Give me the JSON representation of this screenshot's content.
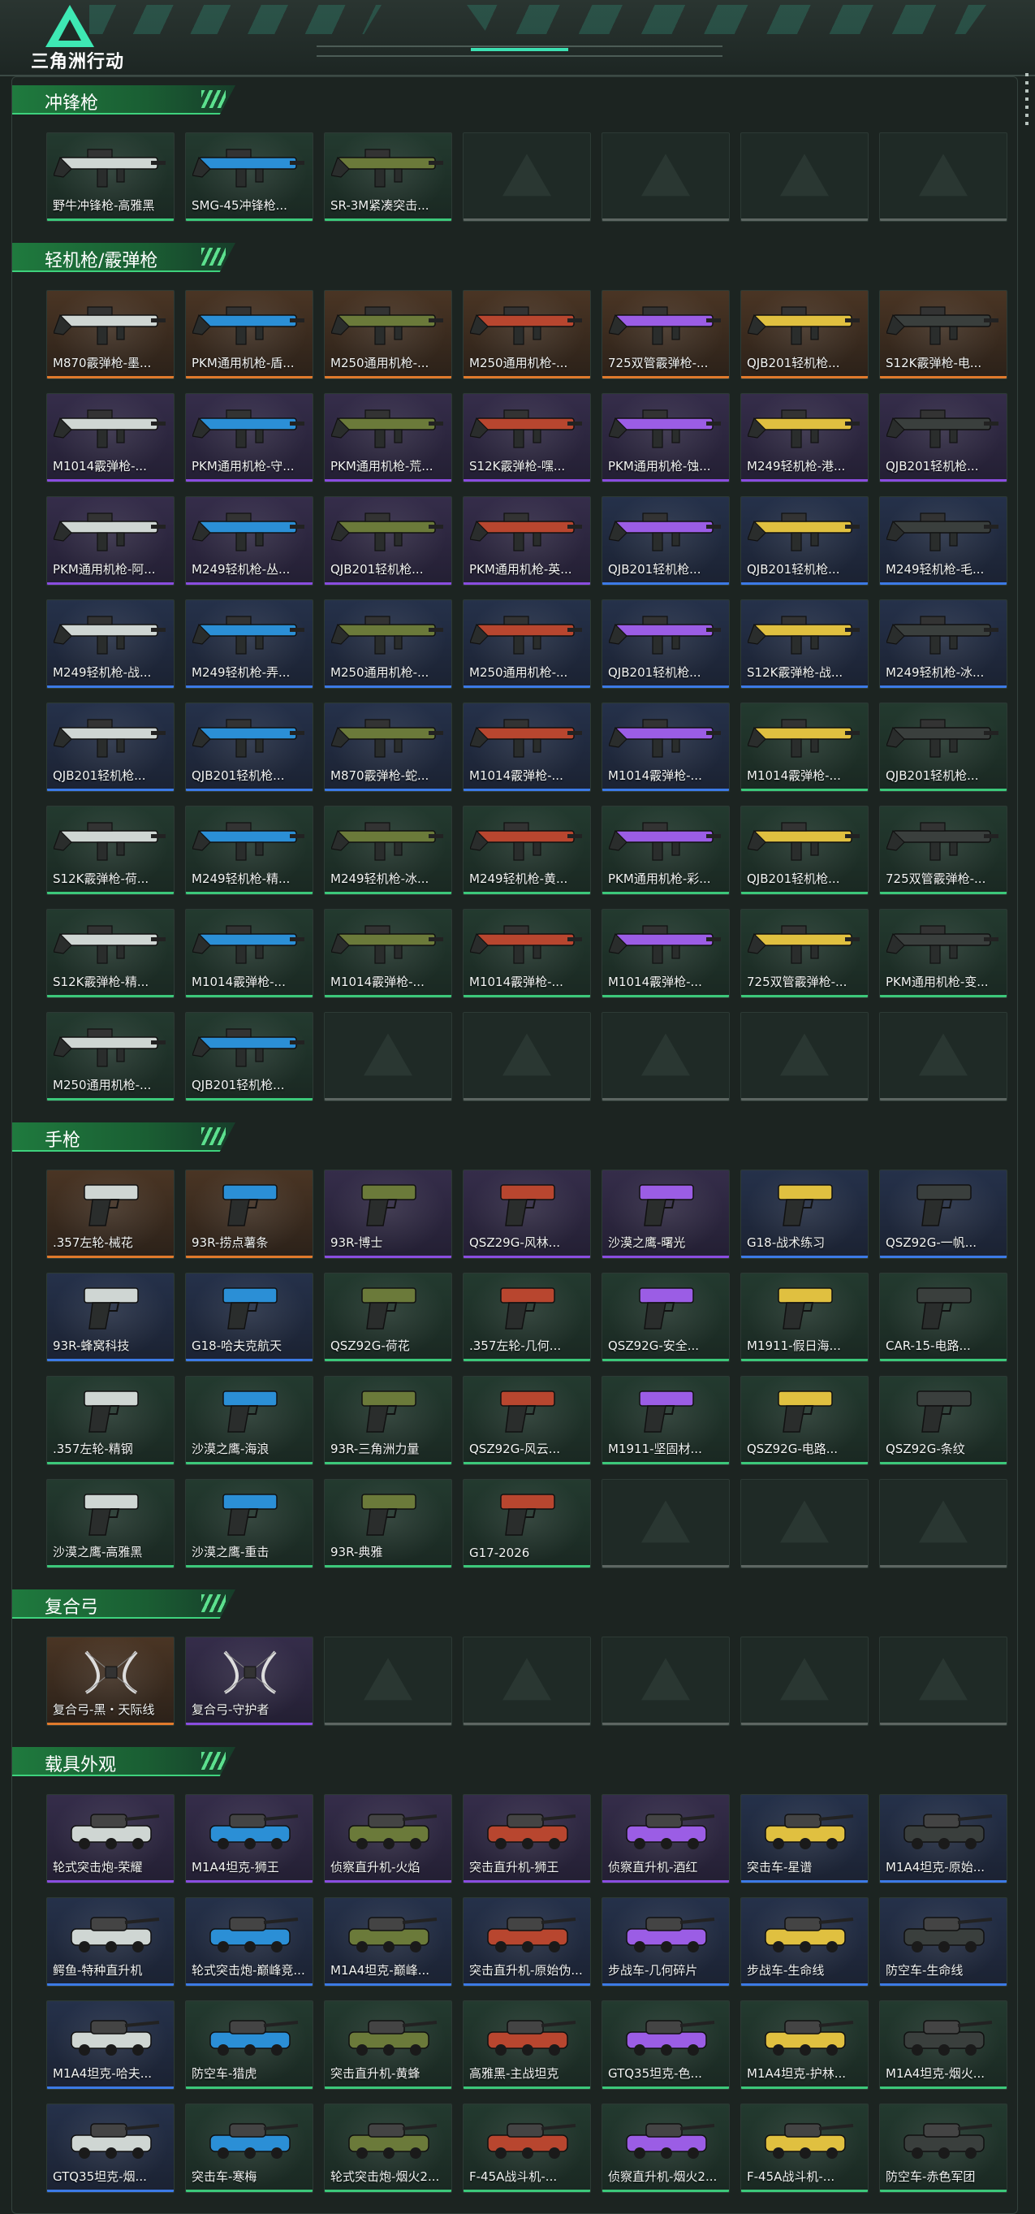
{
  "header": {
    "logo_text": "三角洲行动"
  },
  "colors": {
    "orange": "#e07a2c",
    "purple": "#8a4de0",
    "blue": "#3c7ae6",
    "green": "#3cc87a",
    "accent": "#3ee8b4"
  },
  "sections": [
    {
      "title": "冲锋枪",
      "icon": "gun",
      "items": [
        {
          "label": "野牛冲锋枪-高雅黑",
          "rarity": "green"
        },
        {
          "label": "SMG-45冲锋枪...",
          "rarity": "green"
        },
        {
          "label": "SR-3M紧凑突击...",
          "rarity": "green"
        }
      ],
      "empty_slots": 4
    },
    {
      "title": "轻机枪/霰弹枪",
      "icon": "gun",
      "items": [
        {
          "label": "M870霰弹枪-墨...",
          "rarity": "orange"
        },
        {
          "label": "PKM通用机枪-盾...",
          "rarity": "orange"
        },
        {
          "label": "M250通用机枪-...",
          "rarity": "orange"
        },
        {
          "label": "M250通用机枪-...",
          "rarity": "orange"
        },
        {
          "label": "725双管霰弹枪-...",
          "rarity": "orange"
        },
        {
          "label": "QJB201轻机枪...",
          "rarity": "orange"
        },
        {
          "label": "S12K霰弹枪-电...",
          "rarity": "orange"
        },
        {
          "label": "M1014霰弹枪-...",
          "rarity": "purple"
        },
        {
          "label": "PKM通用机枪-守...",
          "rarity": "purple"
        },
        {
          "label": "PKM通用机枪-荒...",
          "rarity": "purple"
        },
        {
          "label": "S12K霰弹枪-嘿...",
          "rarity": "purple"
        },
        {
          "label": "PKM通用机枪-蚀...",
          "rarity": "purple"
        },
        {
          "label": "M249轻机枪-港...",
          "rarity": "purple"
        },
        {
          "label": "QJB201轻机枪...",
          "rarity": "purple"
        },
        {
          "label": "PKM通用机枪-阿...",
          "rarity": "purple"
        },
        {
          "label": "M249轻机枪-丛...",
          "rarity": "purple"
        },
        {
          "label": "QJB201轻机枪...",
          "rarity": "purple"
        },
        {
          "label": "PKM通用机枪-英...",
          "rarity": "purple"
        },
        {
          "label": "QJB201轻机枪...",
          "rarity": "blue"
        },
        {
          "label": "QJB201轻机枪...",
          "rarity": "blue"
        },
        {
          "label": "M249轻机枪-毛...",
          "rarity": "blue"
        },
        {
          "label": "M249轻机枪-战...",
          "rarity": "blue"
        },
        {
          "label": "M249轻机枪-弄...",
          "rarity": "blue"
        },
        {
          "label": "M250通用机枪-...",
          "rarity": "blue"
        },
        {
          "label": "M250通用机枪-...",
          "rarity": "blue"
        },
        {
          "label": "QJB201轻机枪...",
          "rarity": "blue"
        },
        {
          "label": "S12K霰弹枪-战...",
          "rarity": "blue"
        },
        {
          "label": "M249轻机枪-冰...",
          "rarity": "blue"
        },
        {
          "label": "QJB201轻机枪...",
          "rarity": "blue"
        },
        {
          "label": "QJB201轻机枪...",
          "rarity": "blue"
        },
        {
          "label": "M870霰弹枪-蛇...",
          "rarity": "blue"
        },
        {
          "label": "M1014霰弹枪-...",
          "rarity": "blue"
        },
        {
          "label": "M1014霰弹枪-...",
          "rarity": "blue"
        },
        {
          "label": "M1014霰弹枪-...",
          "rarity": "green"
        },
        {
          "label": "QJB201轻机枪...",
          "rarity": "green"
        },
        {
          "label": "S12K霰弹枪-荷...",
          "rarity": "green"
        },
        {
          "label": "M249轻机枪-精...",
          "rarity": "green"
        },
        {
          "label": "M249轻机枪-冰...",
          "rarity": "green"
        },
        {
          "label": "M249轻机枪-黄...",
          "rarity": "green"
        },
        {
          "label": "PKM通用机枪-彩...",
          "rarity": "green"
        },
        {
          "label": "QJB201轻机枪...",
          "rarity": "green"
        },
        {
          "label": "725双管霰弹枪-...",
          "rarity": "green"
        },
        {
          "label": "S12K霰弹枪-精...",
          "rarity": "green"
        },
        {
          "label": "M1014霰弹枪-...",
          "rarity": "green"
        },
        {
          "label": "M1014霰弹枪-...",
          "rarity": "green"
        },
        {
          "label": "M1014霰弹枪-...",
          "rarity": "green"
        },
        {
          "label": "M1014霰弹枪-...",
          "rarity": "green"
        },
        {
          "label": "725双管霰弹枪-...",
          "rarity": "green"
        },
        {
          "label": "PKM通用机枪-变...",
          "rarity": "green"
        },
        {
          "label": "M250通用机枪-...",
          "rarity": "green"
        },
        {
          "label": "QJB201轻机枪...",
          "rarity": "green"
        }
      ],
      "empty_slots": 5
    },
    {
      "title": "手枪",
      "icon": "pistol",
      "items": [
        {
          "label": ".357左轮-械花",
          "rarity": "orange"
        },
        {
          "label": "93R-捞点薯条",
          "rarity": "orange"
        },
        {
          "label": "93R-博士",
          "rarity": "purple"
        },
        {
          "label": "QSZ29G-风林...",
          "rarity": "purple"
        },
        {
          "label": "沙漠之鹰-曙光",
          "rarity": "purple"
        },
        {
          "label": "G18-战术练习",
          "rarity": "blue"
        },
        {
          "label": "QSZ92G-一帆...",
          "rarity": "blue"
        },
        {
          "label": "93R-蜂窝科技",
          "rarity": "blue"
        },
        {
          "label": "G18-哈夫克航天",
          "rarity": "blue"
        },
        {
          "label": "QSZ92G-荷花",
          "rarity": "green"
        },
        {
          "label": ".357左轮-几何...",
          "rarity": "green"
        },
        {
          "label": "QSZ92G-安全...",
          "rarity": "green"
        },
        {
          "label": "M1911-假日海...",
          "rarity": "green"
        },
        {
          "label": "CAR-15-电路...",
          "rarity": "green"
        },
        {
          "label": ".357左轮-精钢",
          "rarity": "green"
        },
        {
          "label": "沙漠之鹰-海浪",
          "rarity": "green"
        },
        {
          "label": "93R-三角洲力量",
          "rarity": "green"
        },
        {
          "label": "QSZ92G-风云...",
          "rarity": "green"
        },
        {
          "label": "M1911-坚固材...",
          "rarity": "green"
        },
        {
          "label": "QSZ92G-电路...",
          "rarity": "green"
        },
        {
          "label": "QSZ92G-条纹",
          "rarity": "green"
        },
        {
          "label": "沙漠之鹰-高雅黑",
          "rarity": "green"
        },
        {
          "label": "沙漠之鹰-重击",
          "rarity": "green"
        },
        {
          "label": "93R-典雅",
          "rarity": "green"
        },
        {
          "label": "G17-2026",
          "rarity": "green"
        }
      ],
      "empty_slots": 3
    },
    {
      "title": "复合弓",
      "icon": "bow",
      "items": [
        {
          "label": "复合弓-黑・天际线",
          "rarity": "orange"
        },
        {
          "label": "复合弓-守护者",
          "rarity": "purple"
        }
      ],
      "empty_slots": 5
    },
    {
      "title": "载具外观",
      "icon": "vehicle",
      "items": [
        {
          "label": "轮式突击炮-荣耀",
          "rarity": "purple"
        },
        {
          "label": "M1A4坦克-狮王",
          "rarity": "purple"
        },
        {
          "label": "侦察直升机-火焰",
          "rarity": "purple"
        },
        {
          "label": "突击直升机-狮王",
          "rarity": "purple"
        },
        {
          "label": "侦察直升机-酒红",
          "rarity": "purple"
        },
        {
          "label": "突击车-星谱",
          "rarity": "blue"
        },
        {
          "label": "M1A4坦克-原始...",
          "rarity": "blue"
        },
        {
          "label": "鳄鱼-特种直升机",
          "rarity": "blue"
        },
        {
          "label": "轮式突击炮-巅峰竞...",
          "rarity": "blue"
        },
        {
          "label": "M1A4坦克-巅峰...",
          "rarity": "blue"
        },
        {
          "label": "突击直升机-原始伪...",
          "rarity": "blue"
        },
        {
          "label": "步战车-几何碎片",
          "rarity": "blue"
        },
        {
          "label": "步战车-生命线",
          "rarity": "blue"
        },
        {
          "label": "防空车-生命线",
          "rarity": "blue"
        },
        {
          "label": "M1A4坦克-哈夫...",
          "rarity": "blue"
        },
        {
          "label": "防空车-猎虎",
          "rarity": "green"
        },
        {
          "label": "突击直升机-黄蜂",
          "rarity": "green"
        },
        {
          "label": "高雅黑-主战坦克",
          "rarity": "green"
        },
        {
          "label": "GTQ35坦克-色...",
          "rarity": "green"
        },
        {
          "label": "M1A4坦克-护林...",
          "rarity": "green"
        },
        {
          "label": "M1A4坦克-烟火...",
          "rarity": "green"
        },
        {
          "label": "GTQ35坦克-烟...",
          "rarity": "blue"
        },
        {
          "label": "突击车-寒梅",
          "rarity": "green"
        },
        {
          "label": "轮式突击炮-烟火2...",
          "rarity": "green"
        },
        {
          "label": "F-45A战斗机-...",
          "rarity": "green"
        },
        {
          "label": "侦察直升机-烟火2...",
          "rarity": "green"
        },
        {
          "label": "F-45A战斗机-...",
          "rarity": "green"
        },
        {
          "label": "防空车-赤色军团",
          "rarity": "green"
        }
      ],
      "empty_slots": 0
    }
  ]
}
